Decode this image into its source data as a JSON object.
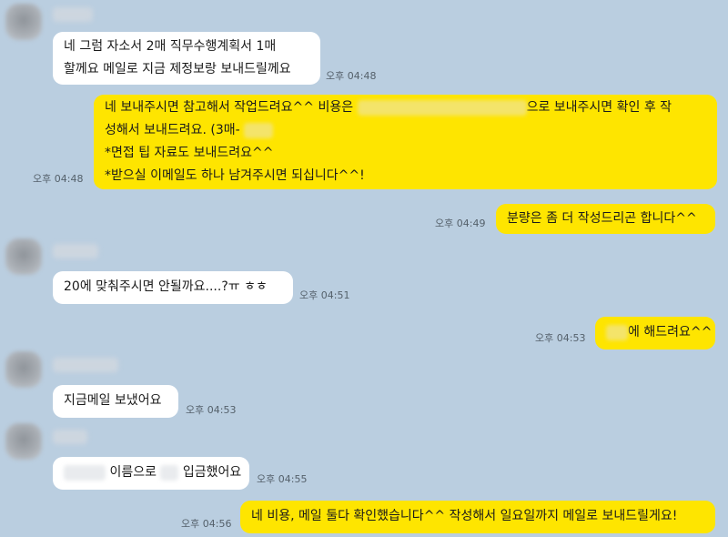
{
  "messages": [
    {
      "id": "m1",
      "dir": "in",
      "lines": [
        "네 그럼 자소서 2매 직무수행계획서 1매",
        "할께요 메일로 지금 제정보랑 보내드릴께요"
      ],
      "time": "오후 04:48"
    },
    {
      "id": "m2",
      "dir": "out",
      "line1_a": "네 보내주시면 참고해서 작업드려요^^ 비용은",
      "line1_b": "으로 보내주시면 확인 후 작",
      "line2": "성해서 보내드려요. (3매-",
      "line3": "*면접 팁 자료도 보내드려요^^",
      "line4": "*받으실 이메일도 하나 남겨주시면 되십니다^^!",
      "time": "오후 04:48"
    },
    {
      "id": "m3",
      "dir": "out",
      "text": "분량은 좀 더 작성드리곤 합니다^^",
      "time": "오후 04:49"
    },
    {
      "id": "m4",
      "dir": "in",
      "text": "20에 맞춰주시면 안될까요....?ㅠ ㅎㅎ",
      "time": "오후 04:51"
    },
    {
      "id": "m5",
      "dir": "out",
      "text": "에 해드려요^^",
      "time": "오후 04:53"
    },
    {
      "id": "m6",
      "dir": "in",
      "text": "지금메일 보냈어요",
      "time": "오후 04:53"
    },
    {
      "id": "m7",
      "dir": "in",
      "text_a": "이름으로",
      "text_b": "입금했어요",
      "time": "오후 04:55"
    },
    {
      "id": "m8",
      "dir": "out",
      "text": "네 비용, 메일 둘다 확인했습니다^^ 작성해서 일요일까지 메일로 보내드릴게요!",
      "time": "오후 04:56"
    }
  ]
}
